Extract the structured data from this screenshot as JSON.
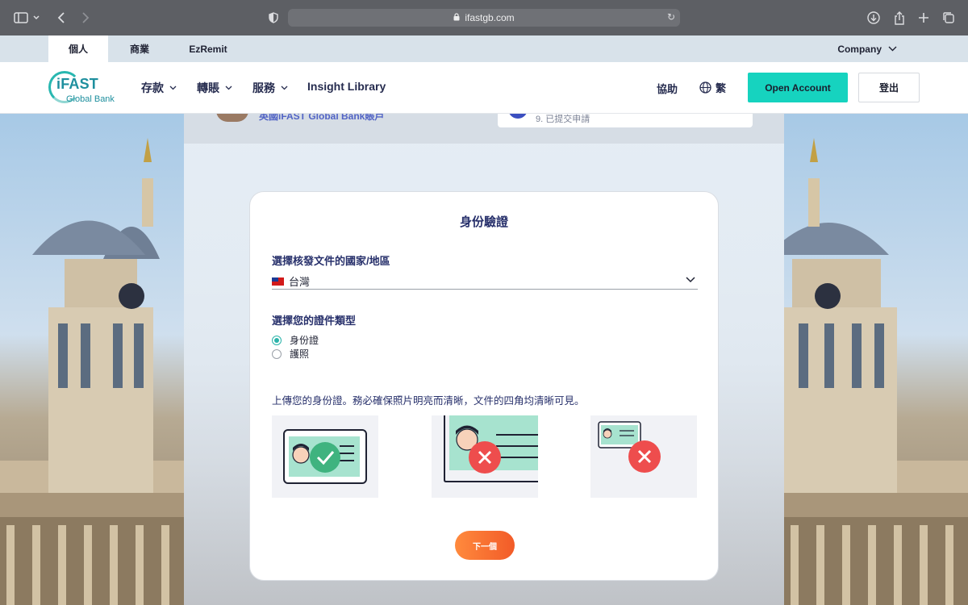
{
  "browser": {
    "url": "ifastgb.com"
  },
  "segments": {
    "items": [
      {
        "label": "個人",
        "active": true
      },
      {
        "label": "商業",
        "active": false
      },
      {
        "label": "EzRemit",
        "active": false
      }
    ],
    "company_label": "Company"
  },
  "logo": {
    "name": "iFAST",
    "sub": "Global Bank"
  },
  "nav": {
    "items": [
      {
        "label": "存款"
      },
      {
        "label": "轉賬"
      },
      {
        "label": "服務"
      },
      {
        "label": "Insight Library"
      }
    ],
    "help_label": "協助",
    "lang_label": "繁",
    "open_account_label": "Open Account",
    "logout_label": "登出"
  },
  "background_peek": {
    "left_text": "英國iFAST Global Bank賬戶",
    "right_text": "9. 已提交申請"
  },
  "form": {
    "title": "身份驗證",
    "country_label": "選擇核發文件的國家/地區",
    "country_value": "台灣",
    "doc_type_label": "選擇您的證件類型",
    "doc_types": [
      {
        "label": "身份證",
        "selected": true
      },
      {
        "label": "護照",
        "selected": false
      }
    ],
    "upload_instruction": "上傳您的身份證。務必確保照片明亮而清晰，文件的四角均清晰可見。",
    "next_label": "下一個"
  },
  "colors": {
    "accent": "#16d3bf",
    "primary_text": "#27306b",
    "next_button": "#f5692e",
    "check_green": "#3fb37f",
    "cross_red": "#ee4d4d"
  }
}
